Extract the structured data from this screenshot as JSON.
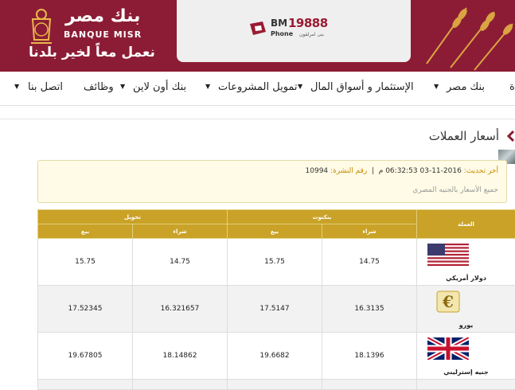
{
  "header": {
    "logo_ar": "بنك مصر",
    "logo_en": "BANQUE MISR",
    "slogan": "نعمل معاً لخير بلدنا",
    "bm_label": "BM",
    "bm_number": "19888",
    "bm_phone": "Phone",
    "bm_sub": "بنى امرلقون"
  },
  "nav": {
    "items": [
      {
        "label": "ة"
      },
      {
        "label": "بنك مصر"
      },
      {
        "label": "الإستثمار و أسواق المال"
      },
      {
        "label": "تمويل المشروعات"
      },
      {
        "label": "بنك أون لاين"
      },
      {
        "label": "وظائف"
      },
      {
        "label": "اتصل بنا"
      }
    ]
  },
  "page": {
    "title": "أسعار العملات"
  },
  "info": {
    "last_update_label": "أخر تحديث:",
    "last_update_value": "2016-11-03 06:32:53 م",
    "separator": "|",
    "bulletin_label": "رقم النشرة:",
    "bulletin_value": "10994",
    "note": "جميع الأسعار بالجنيه المصري"
  },
  "table": {
    "headers": {
      "currency": "العملة",
      "cash": "بنكنوت",
      "transfer": "تحويل",
      "buy": "شراء",
      "sell": "بيع"
    },
    "rows": [
      {
        "name": "دولار أمريكي",
        "flag": "us-flag-icon",
        "cash_buy": "14.75",
        "cash_sell": "15.75",
        "transfer_buy": "14.75",
        "transfer_sell": "15.75"
      },
      {
        "name": "يورو",
        "flag": "euro-icon",
        "cash_buy": "16.3135",
        "cash_sell": "17.5147",
        "transfer_buy": "16.321657",
        "transfer_sell": "17.52345"
      },
      {
        "name": "جنيه إسترليني",
        "flag": "uk-flag-icon",
        "cash_buy": "18.1396",
        "cash_sell": "19.6682",
        "transfer_buy": "18.14862",
        "transfer_sell": "19.67805"
      }
    ]
  },
  "colors": {
    "header_bg": "#8c1c35",
    "table_header": "#c9a227",
    "accent_gold": "#c58a00"
  }
}
